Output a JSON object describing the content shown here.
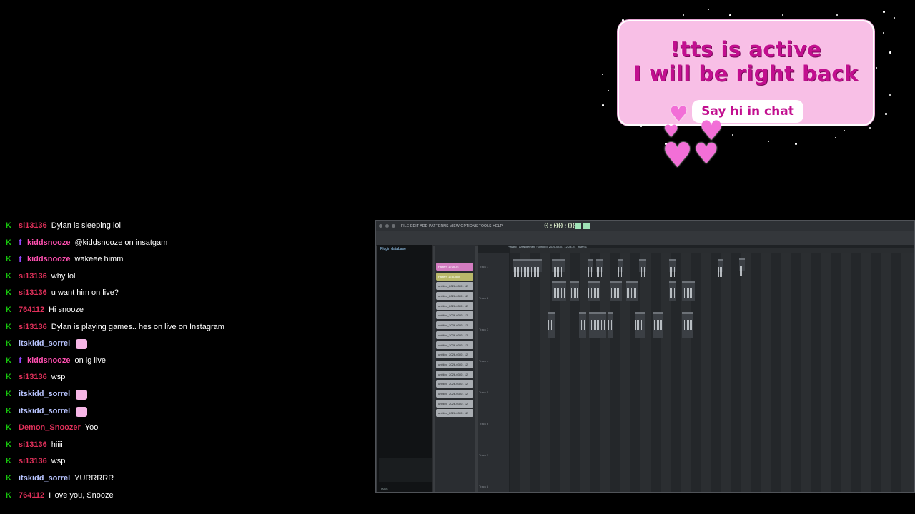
{
  "brb": {
    "line1": "!tts is active",
    "line2": "I will be right back",
    "button": "Say hi in chat"
  },
  "colors": {
    "card_bg": "#f8bfe6",
    "card_text": "#c20f8f",
    "heart": "#f26fd7",
    "mod_badge": "#16c60c"
  },
  "chat": [
    {
      "user": "si13136",
      "color": "#e0305a",
      "badge": "mod",
      "message": "Dylan is sleeping lol"
    },
    {
      "user": "kiddsnooze",
      "color": "#ff4fb0",
      "badge": "mod+sub",
      "message": "@kiddsnooze on insatgam"
    },
    {
      "user": "kiddsnooze",
      "color": "#ff4fb0",
      "badge": "mod+sub",
      "message": "wakeee himm"
    },
    {
      "user": "si13136",
      "color": "#e0305a",
      "badge": "mod",
      "message": "why lol"
    },
    {
      "user": "si13136",
      "color": "#e0305a",
      "badge": "mod",
      "message": "u want him on live?"
    },
    {
      "user": "764112",
      "color": "#e0305a",
      "badge": "mod",
      "message": "Hi snooze"
    },
    {
      "user": "si13136",
      "color": "#e0305a",
      "badge": "mod",
      "message": "Dylan is playing games.. hes on live on Instagram"
    },
    {
      "user": "itskidd_sorrel",
      "color": "#b8c4ff",
      "badge": "mod",
      "message": "",
      "emote": true
    },
    {
      "user": "kiddsnooze",
      "color": "#ff4fb0",
      "badge": "mod+sub",
      "message": "on ig live"
    },
    {
      "user": "si13136",
      "color": "#e0305a",
      "badge": "mod",
      "message": "wsp"
    },
    {
      "user": "itskidd_sorrel",
      "color": "#b8c4ff",
      "badge": "mod",
      "message": "",
      "emote": true
    },
    {
      "user": "itskidd_sorrel",
      "color": "#b8c4ff",
      "badge": "mod",
      "message": "",
      "emote": true
    },
    {
      "user": "Demon_Snoozer",
      "color": "#e0305a",
      "badge": "mod",
      "message": "Yoo"
    },
    {
      "user": "si13136",
      "color": "#e0305a",
      "badge": "mod",
      "message": "hiiii"
    },
    {
      "user": "si13136",
      "color": "#e0305a",
      "badge": "mod",
      "message": "wsp"
    },
    {
      "user": "itskidd_sorrel",
      "color": "#b8c4ff",
      "badge": "mod",
      "message": "YURRRRR"
    },
    {
      "user": "764112",
      "color": "#e0305a",
      "badge": "mod",
      "message": "I love you, Snooze"
    }
  ],
  "daw": {
    "menu": "FILE EDIT ADD PATTERNS VIEW OPTIONS TOOLS HELP",
    "time": "0:00:00",
    "browser_title": "Plugin database",
    "browser_tags": "TAGS",
    "playlist_title": "Playlist - Arrangement › untitled_2026-03-01 12-24-24_Insert 1",
    "patterns": [
      "Pattern 1 (MIDI)",
      "Pattern 1 (Audio)",
      "untitled_2026-03-01 12",
      "untitled_2026-03-01 12",
      "untitled_2026-03-01 12",
      "untitled_2026-03-01 12",
      "untitled_2026-03-01 12",
      "untitled_2026-03-01 12",
      "untitled_2026-03-01 12",
      "untitled_2026-03-01 12",
      "untitled_2026-03-01 12",
      "untitled_2026-03-01 12",
      "untitled_2026-03-01 12",
      "untitled_2026-03-01 12",
      "untitled_2026-03-01 12",
      "untitled_2026-03-01 12"
    ],
    "tracks": [
      "Track 1",
      "Track 2",
      "Track 3",
      "Track 4",
      "Track 5",
      "Track 6",
      "Track 7",
      "Track 8"
    ]
  }
}
